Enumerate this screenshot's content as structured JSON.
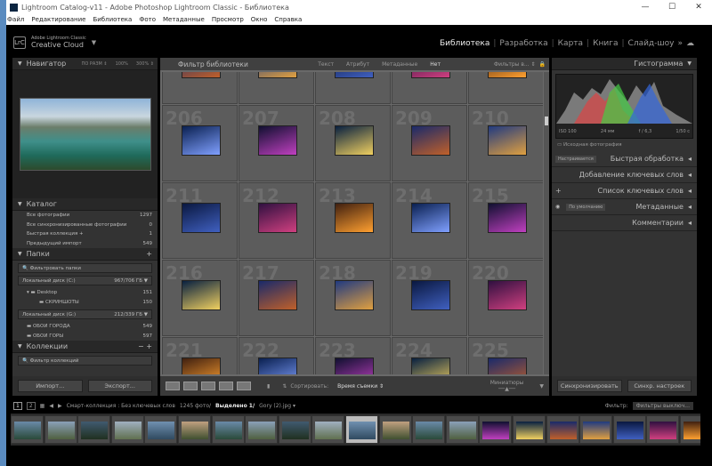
{
  "window": {
    "title": "Lightroom Catalog-v11 - Adobe Photoshop Lightroom Classic - Библиотека",
    "controls": [
      "—",
      "☐",
      "✕"
    ]
  },
  "menu": [
    "Файл",
    "Редактирование",
    "Библиотека",
    "Фото",
    "Метаданные",
    "Просмотр",
    "Окно",
    "Справка"
  ],
  "identity": {
    "logo": "LrC",
    "line1": "Adobe Lightroom Classic",
    "line2": "Creative Cloud"
  },
  "modules": [
    "Библиотека",
    "Разработка",
    "Карта",
    "Книга",
    "Слайд-шоу"
  ],
  "navigator": {
    "title": "Навигатор",
    "options": [
      "ПО РАЗМ ⇕",
      "100%",
      "300% ⇕"
    ]
  },
  "catalog": {
    "title": "Каталог",
    "items": [
      {
        "label": "Все фотографии",
        "count": "1297"
      },
      {
        "label": "Все синхронизированные фотографии",
        "count": "0"
      },
      {
        "label": "Быстрая коллекция +",
        "count": "1"
      },
      {
        "label": "Предыдущий импорт",
        "count": "549"
      }
    ]
  },
  "folders": {
    "title": "Папки",
    "filter": "Фильтровать папки",
    "disk1": {
      "label": "Локальный диск (C:)",
      "size": "967/706 ГБ"
    },
    "f1": {
      "label": "Desktop",
      "count": "151"
    },
    "f2": {
      "label": "СКРИНШОТЫ",
      "count": "150"
    },
    "disk2": {
      "label": "Локальный диск (G:)",
      "size": "212/339 ГБ"
    },
    "f3": {
      "label": "ОБОИ ГОРОДА",
      "count": "549"
    },
    "f4": {
      "label": "ОБОИ ГОРЫ",
      "count": "597"
    }
  },
  "collections": {
    "title": "Коллекции",
    "filter": "Фильтр коллекций"
  },
  "left_buttons": {
    "import": "Импорт...",
    "export": "Экспорт..."
  },
  "filter_bar": {
    "title": "Фильтр библиотеки",
    "opts": [
      "Текст",
      "Атрибут",
      "Метаданные",
      "Нет"
    ],
    "presets": "Фильтры в... ⇕"
  },
  "grid_numbers": [
    "",
    "",
    "",
    "",
    "",
    "206",
    "207",
    "208",
    "209",
    "210",
    "211",
    "212",
    "213",
    "214",
    "215",
    "216",
    "217",
    "218",
    "219",
    "220",
    "221",
    "222",
    "223",
    "224",
    "225"
  ],
  "toolbar": {
    "sort_label": "Сортировать:",
    "sort_value": "Время съемки ⇕",
    "thumbs": "Миниатюры"
  },
  "right": {
    "histogram": "Гистограмма",
    "iso": "ISO 100",
    "focal": "24 мм",
    "aperture": "f / 6,3",
    "shutter": "1/50 с",
    "original": "Исходная фотография",
    "quick": "Быстрая обработка",
    "quick_preset": "Настраивается",
    "kw_add": "Добавление ключевых слов",
    "kw_list": "Список ключевых слов",
    "meta": "Метаданные",
    "meta_preset": "По умолчанию",
    "comments": "Комментарии",
    "sync": "Синхронизировать",
    "sync_settings": "Синхр. настроек"
  },
  "status": {
    "p1": "1",
    "p2": "2",
    "source": "Смарт-коллекция : Без ключевых слов",
    "count": "1245 фото/",
    "selected": "Выделено 1/",
    "file": "Gory (2).jpg ▾",
    "filter_label": "Фильтр:",
    "filter_value": "Фильтры выключ..."
  }
}
